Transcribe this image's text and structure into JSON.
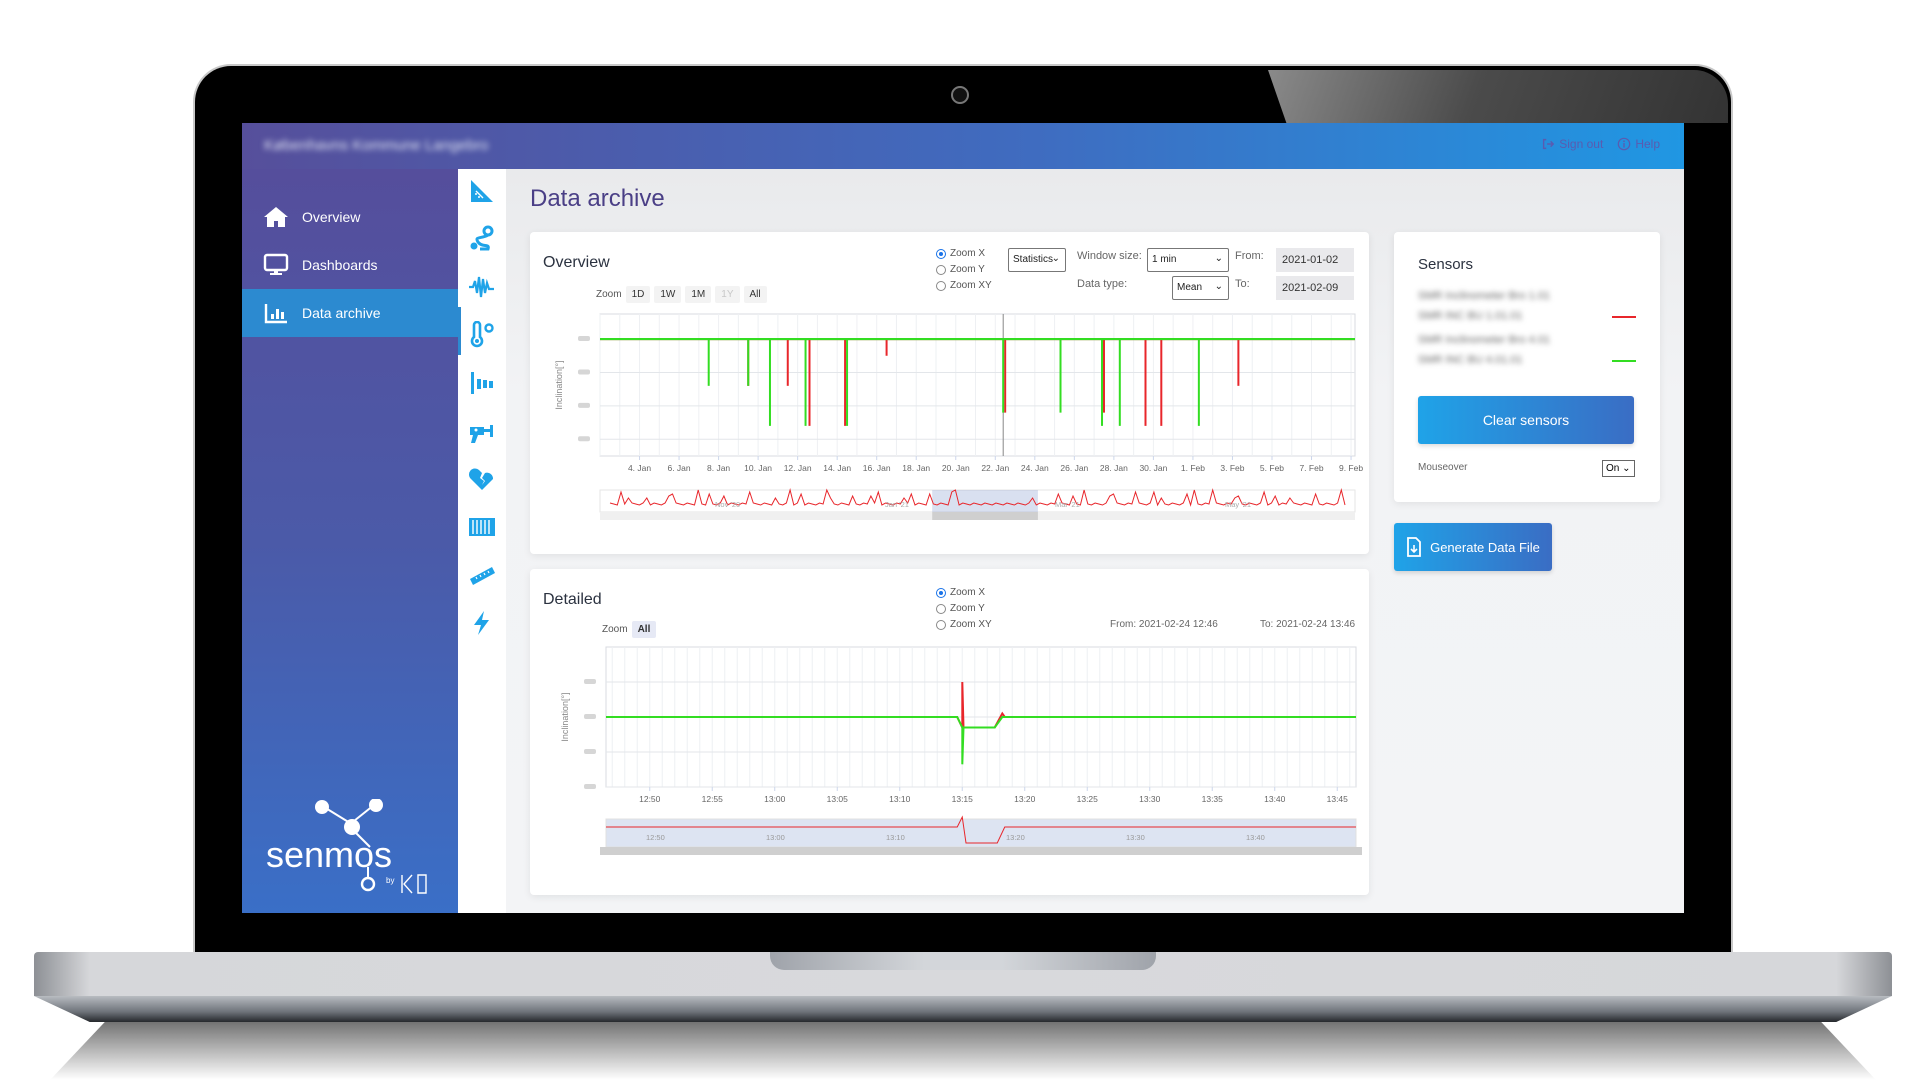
{
  "app": {
    "title": "Københavns Kommune Langebro",
    "sign_out_label": "Sign out",
    "help_label": "Help",
    "accent_color": "#2c8ad0",
    "brand_color": "#4a3f86"
  },
  "sidebar": {
    "items": [
      {
        "label": "Overview",
        "icon": "home-icon",
        "active": false
      },
      {
        "label": "Dashboards",
        "icon": "monitor-icon",
        "active": false
      },
      {
        "label": "Data archive",
        "icon": "bar-chart-icon",
        "active": true
      }
    ],
    "logo_text": "senmos",
    "logo_by": "by"
  },
  "iconbar": {
    "items": [
      "inclination-icon",
      "route-icon",
      "vibration-icon",
      "temperature-icon",
      "level-icon",
      "drill-icon",
      "broken-heart-icon",
      "strain-gauge-icon",
      "ruler-icon",
      "lightning-icon"
    ],
    "active_index": 2
  },
  "page": {
    "title": "Data archive"
  },
  "overview": {
    "title": "Overview",
    "zoom_label": "Zoom",
    "zoom_buttons": [
      {
        "label": "1D",
        "disabled": false
      },
      {
        "label": "1W",
        "disabled": false
      },
      {
        "label": "1M",
        "disabled": false
      },
      {
        "label": "1Y",
        "disabled": true
      },
      {
        "label": "All",
        "disabled": false
      }
    ],
    "zoom_modes": [
      {
        "label": "Zoom X",
        "selected": true
      },
      {
        "label": "Zoom Y",
        "selected": false
      },
      {
        "label": "Zoom XY",
        "selected": false
      }
    ],
    "mode_select": "Statistics",
    "window_size_label": "Window size:",
    "window_size_value": "1 min",
    "data_type_label": "Data type:",
    "data_type_value": "Mean",
    "from_label": "From:",
    "from_value": "2021-01-02",
    "to_label": "To:",
    "to_value": "2021-02-09"
  },
  "detailed": {
    "title": "Detailed",
    "zoom_label": "Zoom",
    "zoom_buttons": [
      {
        "label": "All",
        "selected": true
      }
    ],
    "zoom_modes": [
      {
        "label": "Zoom X",
        "selected": true
      },
      {
        "label": "Zoom Y",
        "selected": false
      },
      {
        "label": "Zoom XY",
        "selected": false
      }
    ],
    "from_text": "From: 2021-02-24 12:46",
    "to_text": "To: 2021-02-24 13:46"
  },
  "sensors": {
    "title": "Sensors",
    "items": [
      {
        "name_line1": "SMR Inclinometer Bro 1.01",
        "name_line2": "SMR INC BU 1.01.01",
        "color": "#e8262b"
      },
      {
        "name_line1": "SMR Inclinometer Bro 4.01",
        "name_line2": "SMR INC BU 4.01.01",
        "color": "#33dd22"
      }
    ],
    "clear_label": "Clear sensors",
    "mouseover_label": "Mouseover",
    "mouseover_value": "On"
  },
  "generate_label": "Generate Data File",
  "chart_data": [
    {
      "type": "line",
      "name": "overview",
      "ylabel": "Inclination[°]",
      "xlabel": "",
      "x_ticks": [
        "4. Jan",
        "6. Jan",
        "8. Jan",
        "10. Jan",
        "12. Jan",
        "14. Jan",
        "16. Jan",
        "18. Jan",
        "20. Jan",
        "22. Jan",
        "24. Jan",
        "26. Jan",
        "28. Jan",
        "30. Jan",
        "1. Feb",
        "3. Feb",
        "5. Feb",
        "7. Feb",
        "9. Feb"
      ],
      "x_range_days": [
        0,
        38.2
      ],
      "x_tick_start_day": 2,
      "x_tick_step_days": 2,
      "y_range": [
        -3.5,
        0.75
      ],
      "y_ticks_hidden": true,
      "baseline": 0,
      "crosshair_day": 20.4,
      "series": [
        {
          "name": "sensor-1",
          "color": "#e8262b",
          "baseline": 0,
          "spikes": [
            {
              "day": 7.5,
              "value": -1.4
            },
            {
              "day": 9.5,
              "value": -1.4
            },
            {
              "day": 10.6,
              "value": -2.6
            },
            {
              "day": 12.4,
              "value": -2.6
            },
            {
              "day": 14.5,
              "value": -0.5
            },
            {
              "day": 20.5,
              "value": -2.2
            },
            {
              "day": 25.5,
              "value": -2.2
            },
            {
              "day": 27.6,
              "value": -2.6
            },
            {
              "day": 28.4,
              "value": -2.6
            },
            {
              "day": 32.3,
              "value": -1.4
            }
          ]
        },
        {
          "name": "sensor-2",
          "color": "#33dd22",
          "baseline": 0,
          "spikes": [
            {
              "day": 5.5,
              "value": -1.4
            },
            {
              "day": 7.5,
              "value": -1.4
            },
            {
              "day": 8.6,
              "value": -2.6
            },
            {
              "day": 10.4,
              "value": -2.6
            },
            {
              "day": 12.5,
              "value": -2.6
            },
            {
              "day": 20.4,
              "value": -2.2
            },
            {
              "day": 23.3,
              "value": -2.2
            },
            {
              "day": 25.4,
              "value": -2.6
            },
            {
              "day": 26.3,
              "value": -2.6
            },
            {
              "day": 30.3,
              "value": -2.6
            }
          ]
        }
      ],
      "navigator": {
        "labels": [
          "Nov '20",
          "Jan '21",
          "Mar '21",
          "May '21"
        ],
        "selected_range": [
          0.44,
          0.58
        ],
        "color": "#e8262b"
      }
    },
    {
      "type": "line",
      "name": "detailed",
      "ylabel": "Inclination[°]",
      "x_ticks": [
        "12:50",
        "12:55",
        "13:00",
        "13:05",
        "13:10",
        "13:15",
        "13:20",
        "13:25",
        "13:30",
        "13:35",
        "13:40",
        "13:45"
      ],
      "x_range_minutes": [
        46.5,
        106.5
      ],
      "x_tick_start_minute": 50,
      "x_tick_step_minutes": 5,
      "y_range": [
        -2,
        2
      ],
      "y_ticks_hidden": true,
      "series": [
        {
          "name": "sensor-1",
          "color": "#e8262b",
          "points": [
            [
              46.5,
              0
            ],
            [
              74.6,
              0
            ],
            [
              75.0,
              -0.3
            ],
            [
              75.0,
              1.0
            ],
            [
              75.1,
              -0.3
            ],
            [
              77.6,
              -0.3
            ],
            [
              78.2,
              0.1
            ],
            [
              78.4,
              0
            ],
            [
              106.5,
              0
            ]
          ]
        },
        {
          "name": "sensor-2",
          "color": "#33dd22",
          "points": [
            [
              46.5,
              0
            ],
            [
              74.6,
              0
            ],
            [
              75.0,
              -0.3
            ],
            [
              75.0,
              -1.35
            ],
            [
              75.1,
              -0.3
            ],
            [
              77.6,
              -0.3
            ],
            [
              78.2,
              0
            ],
            [
              106.5,
              0
            ]
          ]
        }
      ],
      "navigator": {
        "labels": [
          "12:50",
          "13:00",
          "13:10",
          "13:20",
          "13:30",
          "13:40"
        ],
        "selected_range": [
          0,
          1
        ],
        "color": "#e8262b"
      }
    }
  ]
}
